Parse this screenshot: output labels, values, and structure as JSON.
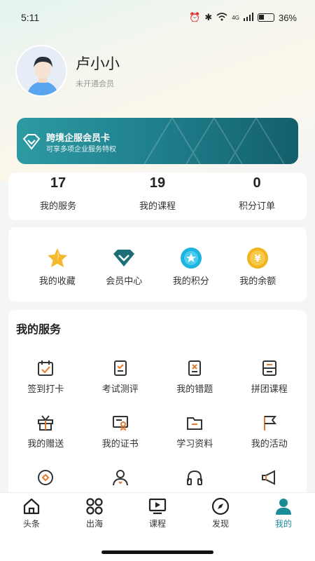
{
  "status": {
    "time": "5:11",
    "battery": "36%",
    "network": "4G"
  },
  "profile": {
    "name": "卢小小",
    "subtitle": "未开通会员"
  },
  "vip_card": {
    "title": "跨境企服会员卡",
    "subtitle": "可享多项企业服务特权",
    "accent": "#1f7f8c"
  },
  "stats": [
    {
      "value": "17",
      "label": "我的服务"
    },
    {
      "value": "19",
      "label": "我的课程"
    },
    {
      "value": "0",
      "label": "积分订单"
    }
  ],
  "quick": [
    {
      "label": "我的收藏",
      "icon": "star-icon"
    },
    {
      "label": "会员中心",
      "icon": "vip-diamond-icon"
    },
    {
      "label": "我的积分",
      "icon": "points-icon"
    },
    {
      "label": "我的余额",
      "icon": "balance-coin-icon"
    }
  ],
  "services": {
    "title": "我的服务",
    "items": [
      {
        "label": "签到打卡",
        "icon": "calendar-check-icon"
      },
      {
        "label": "考试测评",
        "icon": "exam-clipboard-icon"
      },
      {
        "label": "我的错题",
        "icon": "wrong-answer-icon"
      },
      {
        "label": "拼团课程",
        "icon": "group-course-icon"
      },
      {
        "label": "我的赠送",
        "icon": "gift-icon"
      },
      {
        "label": "我的证书",
        "icon": "certificate-icon"
      },
      {
        "label": "学习资料",
        "icon": "folder-icon"
      },
      {
        "label": "我的活动",
        "icon": "flag-icon"
      },
      {
        "label": "",
        "icon": "disc-icon"
      },
      {
        "label": "",
        "icon": "user-pin-icon"
      },
      {
        "label": "",
        "icon": "headphones-icon"
      },
      {
        "label": "",
        "icon": "megaphone-icon"
      }
    ]
  },
  "tabs": [
    {
      "label": "头条",
      "icon": "home-icon",
      "active": false
    },
    {
      "label": "出海",
      "icon": "grid-icon",
      "active": false
    },
    {
      "label": "课程",
      "icon": "video-icon",
      "active": false
    },
    {
      "label": "发现",
      "icon": "compass-icon",
      "active": false
    },
    {
      "label": "我的",
      "icon": "user-icon",
      "active": true
    }
  ],
  "colors": {
    "accent": "#1a8c96",
    "orange": "#e8792b"
  }
}
